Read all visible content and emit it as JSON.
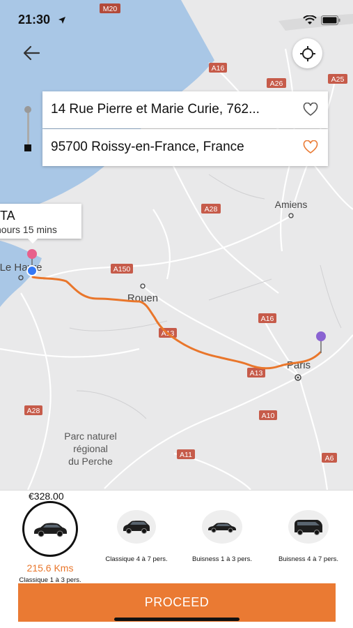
{
  "status_bar": {
    "time": "21:30"
  },
  "map": {
    "cities": [
      "Amiens",
      "Rouen",
      "Paris",
      "Le Havre"
    ],
    "region_label_lines": [
      "Parc naturel",
      "régional",
      "du Perche"
    ],
    "road_labels": [
      "M20",
      "A16",
      "A26",
      "A25",
      "A28",
      "A150",
      "A16",
      "A13",
      "A13",
      "A28",
      "A10",
      "A11",
      "A6"
    ]
  },
  "route": {
    "from_address": "14 Rue Pierre et Marie Curie, 762...",
    "to_address": "95700 Roissy-en-France, France",
    "eta_title": "TA",
    "eta_duration": "hours 15 mins"
  },
  "booking": {
    "price": "€328.00",
    "distance": "215.6 Kms",
    "vehicles": [
      {
        "label": "Classique 1 à 3 pers.",
        "selected": true
      },
      {
        "label": "Classique 4 à 7 pers.",
        "selected": false
      },
      {
        "label": "Buisness 1 à 3 pers.",
        "selected": false
      },
      {
        "label": "Buisness 4 à 7 pers.",
        "selected": false
      }
    ],
    "proceed_label": "PROCEED"
  },
  "colors": {
    "accent": "#ea7a33",
    "route": "#e9762b",
    "sea": "#a9c7e6",
    "land": "#e9e9ea"
  }
}
